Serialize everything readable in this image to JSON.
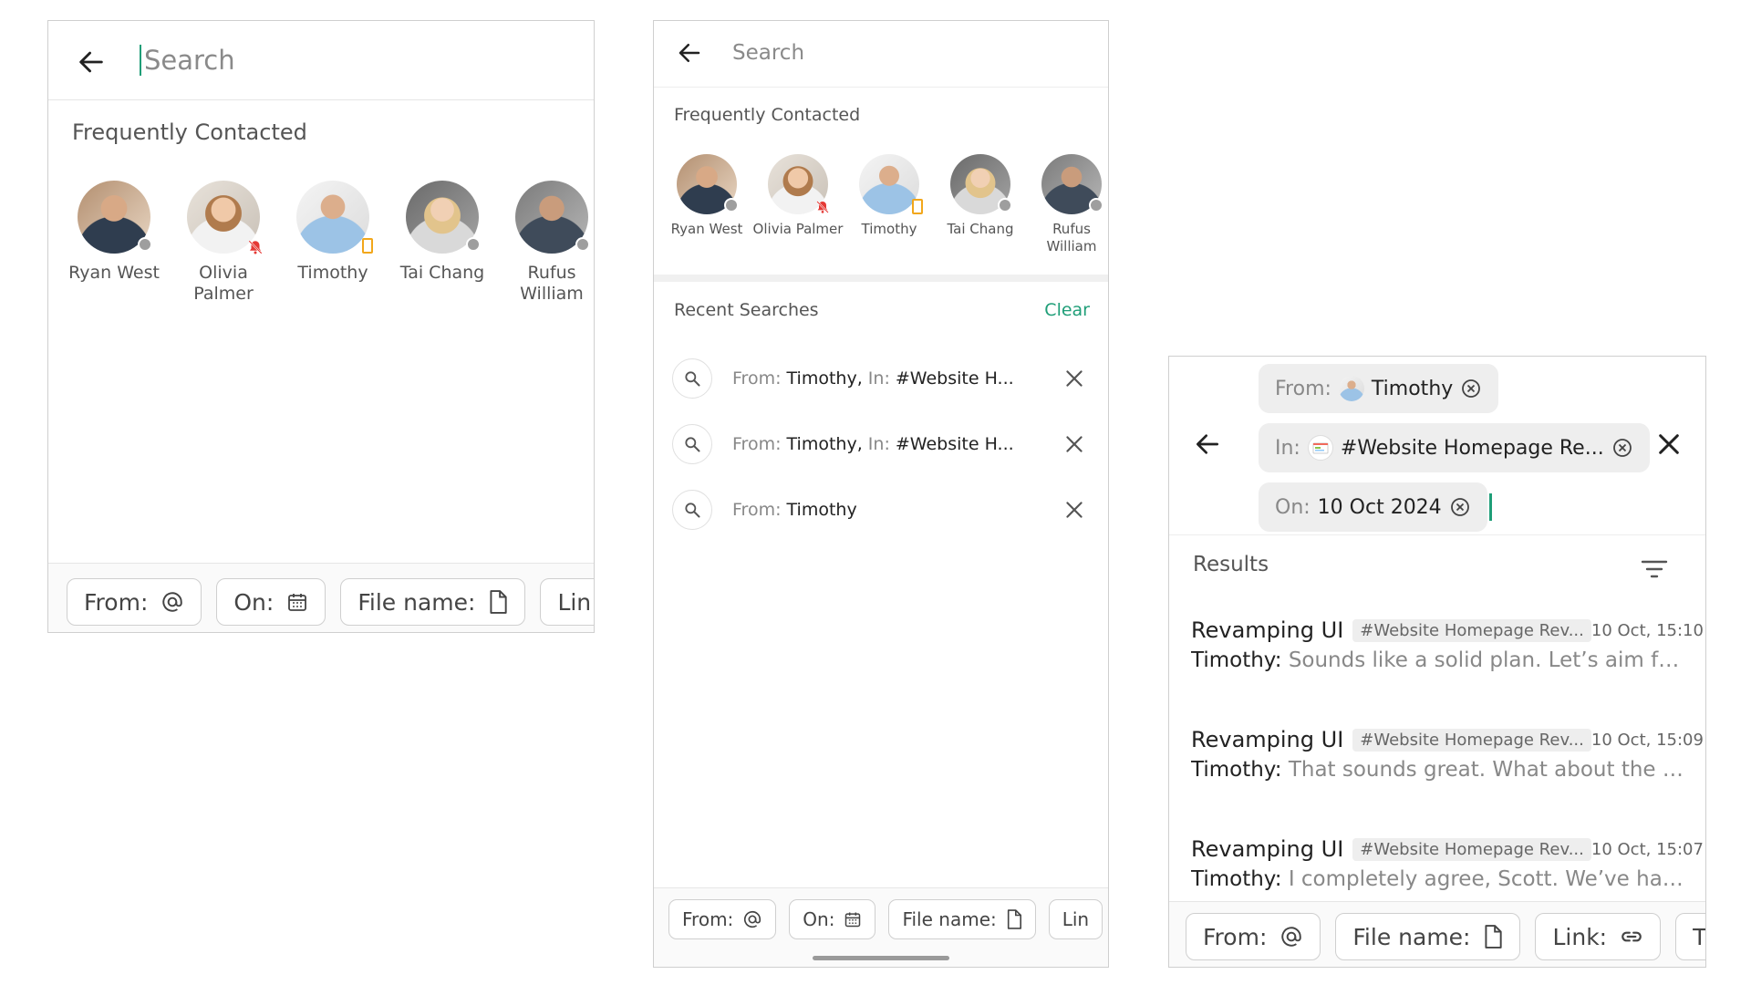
{
  "contacts": [
    {
      "name": "Ryan West",
      "status": "offline",
      "avatar": "av-ryan"
    },
    {
      "name": "Olivia Palmer",
      "status": "muted",
      "avatar": "av-olivia"
    },
    {
      "name": "Timothy",
      "status": "away",
      "avatar": "av-timothy"
    },
    {
      "name": "Tai Chang",
      "status": "offline",
      "avatar": "av-tai"
    },
    {
      "name": "Rufus William",
      "status": "offline",
      "avatar": "av-rufus"
    }
  ],
  "screen1": {
    "search_placeholder": "Search",
    "frequent_title": "Frequently Contacted",
    "filter_chips": [
      {
        "label": "From:",
        "icon": "at-icon"
      },
      {
        "label": "On:",
        "icon": "calendar-icon"
      },
      {
        "label": "File name:",
        "icon": "file-icon"
      },
      {
        "label": "Lin",
        "icon": ""
      }
    ]
  },
  "screen2": {
    "search_placeholder": "Search",
    "frequent_title": "Frequently Contacted",
    "recent_title": "Recent Searches",
    "clear_label": "Clear",
    "recent": [
      {
        "from_label": "From:",
        "from_value": "Timothy,",
        "in_label": "In:",
        "in_value": "#Website H..."
      },
      {
        "from_label": "From:",
        "from_value": "Timothy,",
        "in_label": "In:",
        "in_value": "#Website H..."
      },
      {
        "from_label": "From:",
        "from_value": "Timothy",
        "in_label": "",
        "in_value": ""
      }
    ],
    "filter_chips": [
      {
        "label": "From:",
        "icon": "at-icon"
      },
      {
        "label": "On:",
        "icon": "calendar-icon"
      },
      {
        "label": "File name:",
        "icon": "file-icon"
      },
      {
        "label": "Lin",
        "icon": ""
      }
    ]
  },
  "screen3": {
    "active_filters": {
      "from": {
        "label": "From:",
        "value": "Timothy"
      },
      "in": {
        "label": "In:",
        "value": "#Website Homepage Re..."
      },
      "on": {
        "label": "On:",
        "value": "10 Oct 2024"
      }
    },
    "results_title": "Results",
    "results": [
      {
        "title": "Revamping UI",
        "channel": "#Website Homepage Rev...",
        "time": "10 Oct, 15:10",
        "sender": "Timothy:",
        "snippet": "Sounds like a solid plan. Let’s aim for a..."
      },
      {
        "title": "Revamping UI",
        "channel": "#Website Homepage Rev...",
        "time": "10 Oct, 15:09",
        "sender": "Timothy:",
        "snippet": "That sounds great. What about the nav..."
      },
      {
        "title": "Revamping UI",
        "channel": "#Website Homepage Rev...",
        "time": "10 Oct, 15:07",
        "sender": "Timothy:",
        "snippet": "I completely agree, Scott. We’ve had s..."
      }
    ],
    "filter_chips": [
      {
        "label": "From:",
        "icon": "at-icon"
      },
      {
        "label": "File name:",
        "icon": "file-icon"
      },
      {
        "label": "Link:",
        "icon": "link-icon"
      },
      {
        "label": "T",
        "icon": ""
      }
    ]
  },
  "colors": {
    "accent": "#1f9e78",
    "chip_bg": "#eeeeee",
    "border": "#cfcfcf"
  }
}
